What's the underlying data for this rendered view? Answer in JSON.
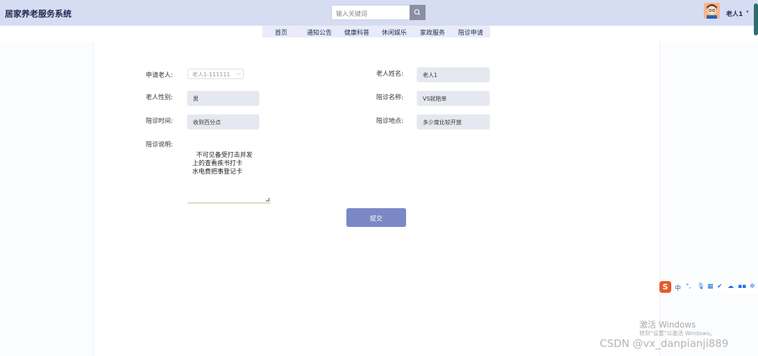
{
  "app": {
    "title": "居家养老服务系统"
  },
  "search": {
    "placeholder": "输入关键词"
  },
  "user": {
    "name": "老人1"
  },
  "nav": {
    "items": [
      "首页",
      "通知公告",
      "健康科普",
      "休闲娱乐",
      "家政服务",
      "陪诊申请"
    ]
  },
  "form": {
    "labels": {
      "applicant": "申请老人:",
      "elder_name": "老人姓名:",
      "gender": "老人性别:",
      "escort_name": "陪诊名称:",
      "escort_time": "陪诊时间:",
      "escort_place": "陪诊地点:",
      "escort_desc": "陪诊说明:"
    },
    "values": {
      "applicant": "老人1-111111",
      "elder_name": "老人1",
      "gender": "男",
      "escort_name": "VS就陪单",
      "escort_time": "收到百分点",
      "escort_place": "多少度比较开放",
      "escort_desc": "不可见备受打击并发\n上的查看疾书打卡\n水电费把事登记卡"
    },
    "submit_label": "提交"
  },
  "ime": {
    "logo": "S",
    "lang": "中"
  },
  "watermark": {
    "line1": "激活 Windows",
    "line2": "转到\"设置\"以激活 Windows。",
    "csdn": "CSDN @vx_danpianji889"
  }
}
